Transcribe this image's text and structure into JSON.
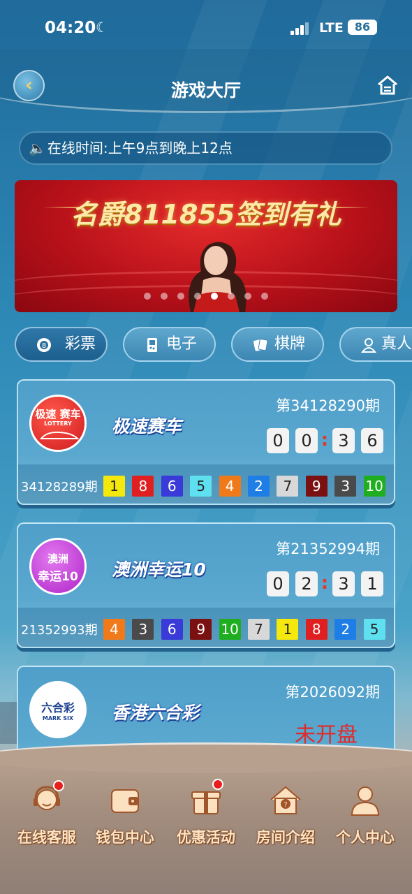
{
  "status_bar": {
    "time": "04:20",
    "network": "LTE",
    "battery": "86"
  },
  "header": {
    "title": "游戏大厅"
  },
  "notice": {
    "text": "在线时间:上午9点到晚上12点"
  },
  "banner": {
    "headline": "名爵811855签到有礼",
    "slide_count": 8,
    "active_slide": 5
  },
  "categories": [
    {
      "label": "彩票",
      "icon": "lottery-ball-icon",
      "active": true
    },
    {
      "label": "电子",
      "icon": "gamepad-icon",
      "active": false
    },
    {
      "label": "棋牌",
      "icon": "cards-icon",
      "active": false
    },
    {
      "label": "真人",
      "icon": "person-icon",
      "active": false
    }
  ],
  "games": [
    {
      "name": "极速赛车",
      "logo": {
        "line1": "极速",
        "line2": "赛车",
        "sub": "LOTTERY"
      },
      "current_period": "第34128290期",
      "countdown": [
        "0",
        "0",
        "3",
        "6"
      ],
      "last_period": "34128289期",
      "results": [
        "1",
        "8",
        "6",
        "5",
        "4",
        "2",
        "7",
        "9",
        "3",
        "10"
      ]
    },
    {
      "name": "澳洲幸运10",
      "logo": {
        "line1": "澳洲",
        "line2": "幸运10"
      },
      "current_period": "第21352994期",
      "countdown": [
        "0",
        "2",
        "3",
        "1"
      ],
      "last_period": "21352993期",
      "results": [
        "4",
        "3",
        "6",
        "9",
        "10",
        "7",
        "1",
        "8",
        "2",
        "5"
      ]
    },
    {
      "name": "香港六合彩",
      "logo": {
        "line1": "六合彩",
        "line2": "MARK SIX"
      },
      "current_period": "第2026092期",
      "status": "未开盘"
    }
  ],
  "ball_colors": {
    "1": "#f5e80c",
    "2": "#1f7ee6",
    "3": "#4a4a4a",
    "4": "#f07a19",
    "5": "#5fe0f0",
    "6": "#3a3ad8",
    "7": "#d8d8d8",
    "8": "#e02020",
    "9": "#7a1010",
    "10": "#1fae1f"
  },
  "bottom_nav": [
    {
      "label": "在线客服",
      "icon": "customer-service-icon",
      "badge": true
    },
    {
      "label": "钱包中心",
      "icon": "wallet-icon",
      "badge": false
    },
    {
      "label": "优惠活动",
      "icon": "gift-icon",
      "badge": true
    },
    {
      "label": "房间介绍",
      "icon": "room-info-icon",
      "badge": false
    },
    {
      "label": "个人中心",
      "icon": "profile-icon",
      "badge": false
    }
  ]
}
